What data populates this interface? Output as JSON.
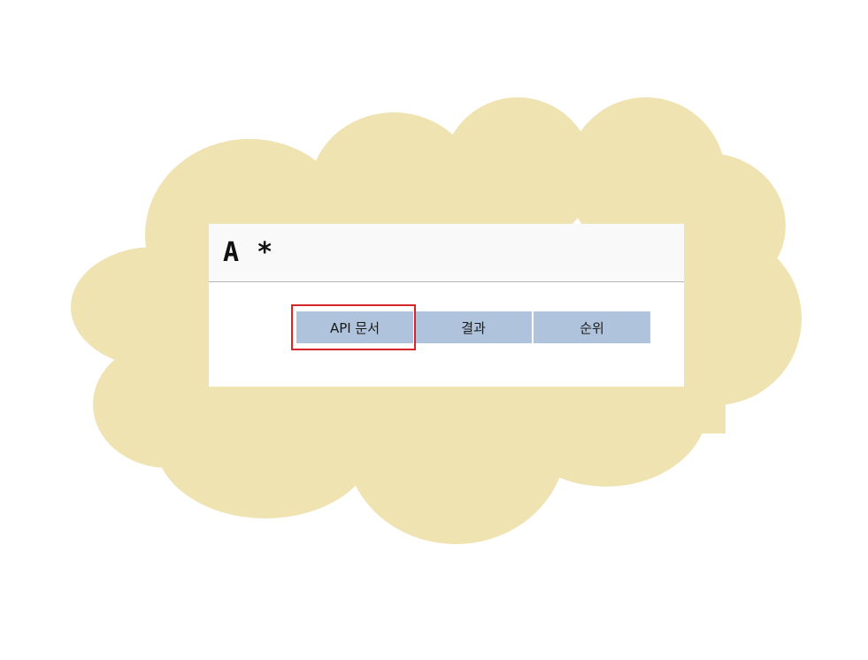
{
  "app": {
    "title": "A *"
  },
  "nav": {
    "items": [
      {
        "label": "API 문서"
      },
      {
        "label": "결과"
      },
      {
        "label": "순위"
      }
    ]
  },
  "colors": {
    "cloud": "#efe3b2",
    "nav_button": "#afc4dc",
    "highlight": "#d6262b",
    "header_background": "#f9f9f9"
  }
}
